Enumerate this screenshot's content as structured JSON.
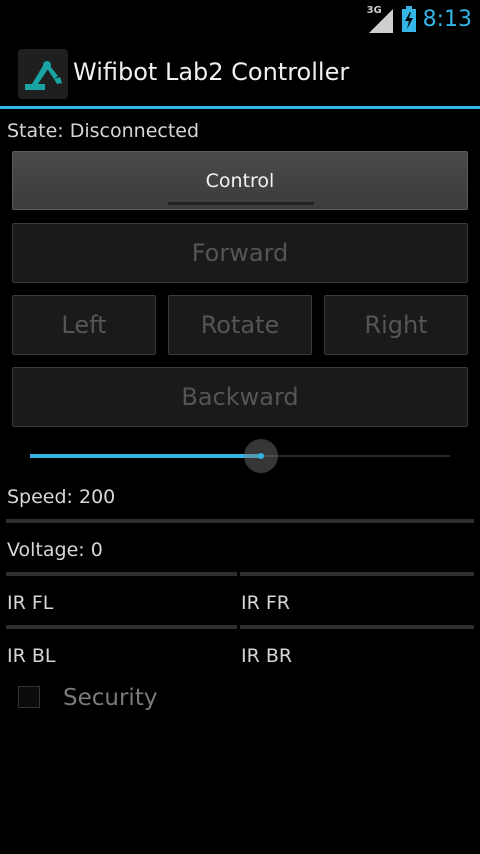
{
  "status_bar": {
    "network": "3G",
    "time": "8:13"
  },
  "action_bar": {
    "title": "Wifibot Lab2 Controller",
    "icon": "robot-arm-icon"
  },
  "state_text": "State: Disconnected",
  "control_button": "Control",
  "direction_buttons": {
    "forward": "Forward",
    "left": "Left",
    "rotate": "Rotate",
    "right": "Right",
    "backward": "Backward"
  },
  "speed_slider": {
    "level": 0.55
  },
  "speed_text": "Speed: 200",
  "voltage_text": "Voltage: 0",
  "ir": {
    "fl": "IR FL",
    "fr": "IR FR",
    "bl": "IR BL",
    "br": "IR BR"
  },
  "security": {
    "label": "Security",
    "checked": false
  },
  "colors": {
    "accent": "#33b5e5",
    "background": "#000000"
  }
}
